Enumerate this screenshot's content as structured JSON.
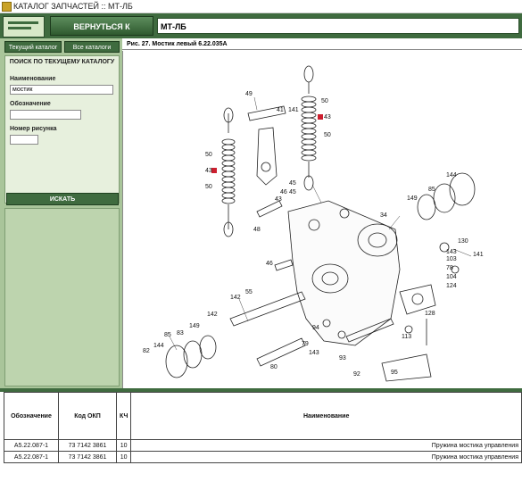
{
  "window": {
    "title": "КАТАЛОГ ЗАПЧАСТЕЙ :: МТ-ЛБ"
  },
  "toolbar": {
    "back_label": "ВЕРНУТЬСЯ К РАЗДЕЛАМ",
    "model_value": "МТ-ЛБ"
  },
  "sidebar": {
    "tabs": [
      {
        "label": "Текущий каталог"
      },
      {
        "label": "Все каталоги"
      }
    ],
    "search": {
      "title": "ПОИСК ПО ТЕКУЩЕМУ КАТАЛОГУ",
      "name_label": "Наименование",
      "name_value": "мостик",
      "designation_label": "Обозначение",
      "designation_value": "",
      "figure_label": "Номер рисунка",
      "figure_value": "",
      "button_label": "ИСКАТЬ"
    }
  },
  "figure": {
    "caption": "Рис. 27. Мостик левый 6.22.035А",
    "callouts": [
      "49",
      "41",
      "141",
      "50",
      "43",
      "50",
      "50",
      "43",
      "50",
      "45",
      "46",
      "43",
      "45",
      "48",
      "144",
      "85",
      "149",
      "130",
      "34",
      "143",
      "103",
      "141",
      "78",
      "104",
      "124",
      "46",
      "55",
      "142",
      "142",
      "149",
      "83",
      "85",
      "144",
      "82",
      "79",
      "143",
      "94",
      "93",
      "113",
      "92",
      "95",
      "80",
      "128"
    ]
  },
  "parts_table": {
    "headers": [
      "Обозначение",
      "Код ОКП",
      "КЧ",
      "Наименование"
    ],
    "rows": [
      [
        "А5.22.087-1",
        "73 7142 3861",
        "10",
        "Пружина мостика управления"
      ],
      [
        "А5.22.087-1",
        "73 7142 3861",
        "10",
        "Пружина мостика управления"
      ]
    ]
  },
  "colors": {
    "primary_green": "#3f6b3f",
    "sidebar_green": "#a9c59a",
    "highlight_red": "#cc1f2f"
  },
  "icons": {
    "app": "app-icon"
  }
}
